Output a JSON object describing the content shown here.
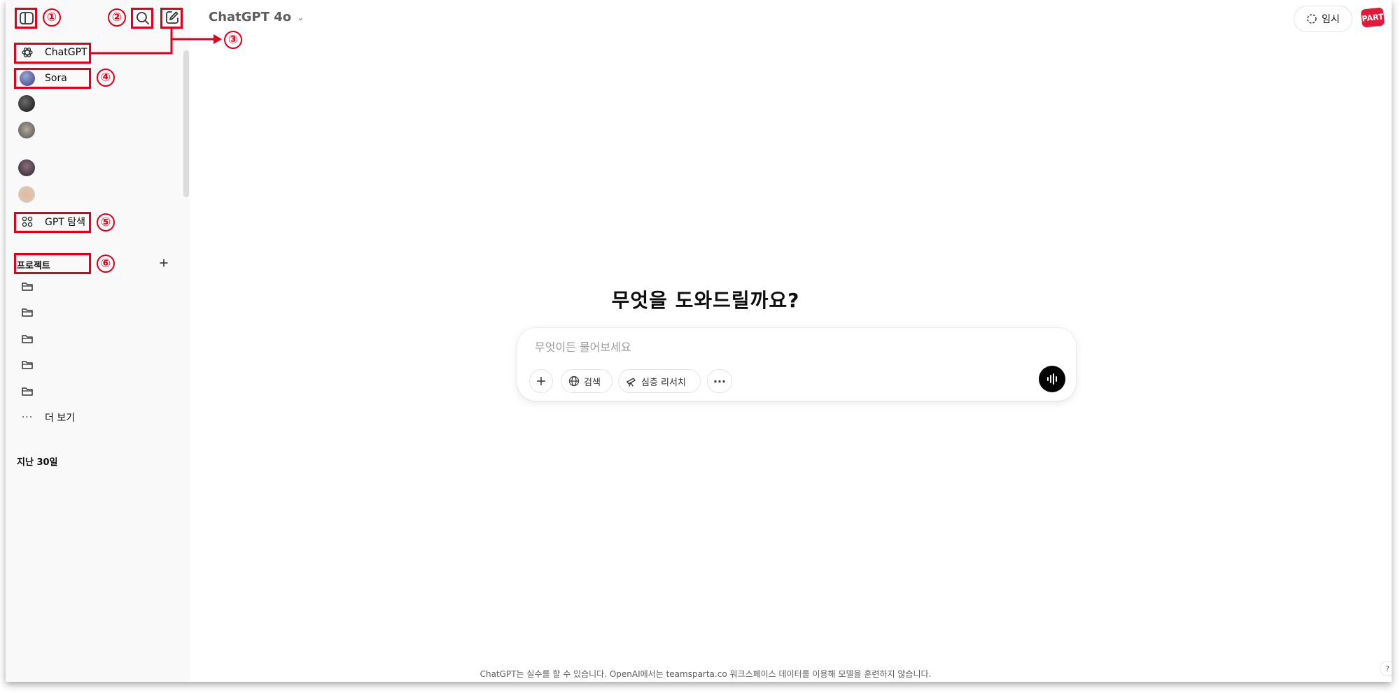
{
  "header": {
    "model_name": "ChatGPT 4o",
    "temp_chat_label": "임시",
    "logo_text": "PART"
  },
  "sidebar": {
    "items": [
      {
        "label": "ChatGPT",
        "icon": "openai-logo-icon"
      },
      {
        "label": "Sora",
        "icon": "sora-avatar"
      }
    ],
    "explore_label": "GPT 탐색",
    "projects_title": "프로젝트",
    "more_label": "더 보기",
    "recent_title": "지난 30일"
  },
  "annotations": [
    "①",
    "②",
    "③",
    "④",
    "⑤",
    "⑥"
  ],
  "main": {
    "headline": "무엇을 도와드릴까요?",
    "composer": {
      "placeholder": "무엇이든 물어보세요",
      "search_label": "검색",
      "deep_research_label": "심층 리서치"
    },
    "footer": "ChatGPT는 실수를 할 수 있습니다. OpenAI에서는 teamsparta.co 워크스페이스 데이터를 이용해 모델을 훈련하지 않습니다.",
    "help_label": "?"
  },
  "colors": {
    "annotation_red": "#e0001b",
    "sidebar_bg": "#f9f9f9",
    "logo_red": "#e3193b"
  }
}
